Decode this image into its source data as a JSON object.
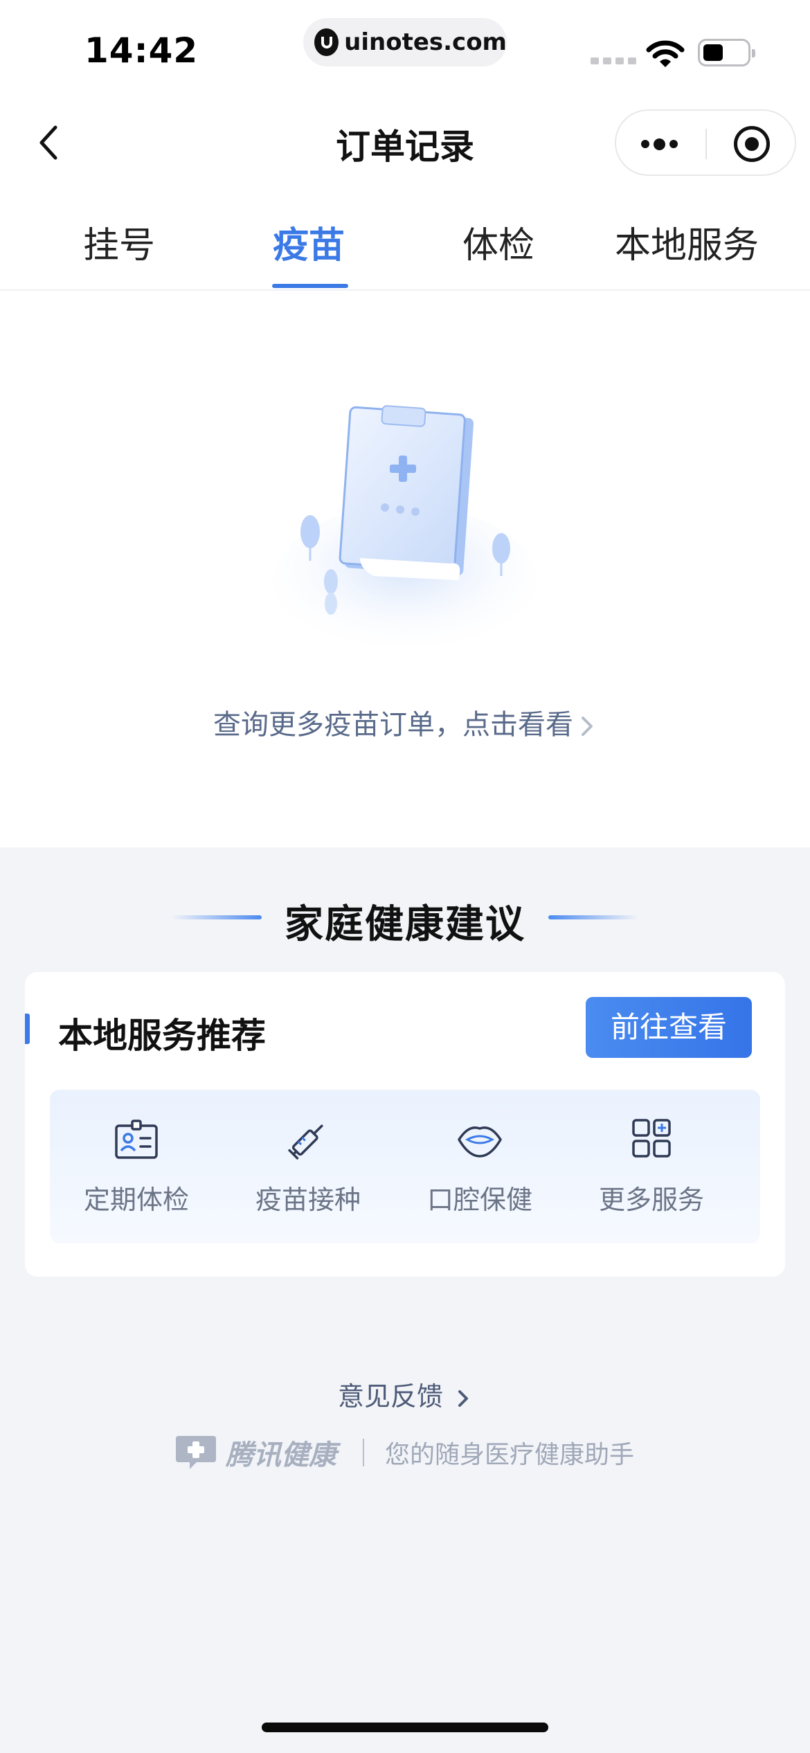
{
  "status_bar": {
    "time": "14:42",
    "url": "uinotes.com"
  },
  "nav": {
    "title": "订单记录"
  },
  "tabs": [
    {
      "label": "挂号",
      "active": false
    },
    {
      "label": "疫苗",
      "active": true
    },
    {
      "label": "体检",
      "active": false
    },
    {
      "label": "本地服务",
      "active": false
    }
  ],
  "empty_state": {
    "link_text": "查询更多疫苗订单，点击看看"
  },
  "family_section": {
    "heading": "家庭健康建议",
    "card": {
      "title": "本地服务推荐",
      "button_label": "前往查看",
      "services": [
        {
          "label": "定期体检",
          "icon": "id-card-icon"
        },
        {
          "label": "疫苗接种",
          "icon": "syringe-icon"
        },
        {
          "label": "口腔保健",
          "icon": "mouth-icon"
        },
        {
          "label": "更多服务",
          "icon": "grid-plus-icon"
        }
      ]
    }
  },
  "footer": {
    "feedback": "意见反馈",
    "brand": "腾讯健康",
    "slogan": "您的随身医疗健康助手"
  },
  "colors": {
    "accent": "#3b7ae6",
    "page_bg": "#f2f4f8",
    "link_text": "#596a8a"
  }
}
